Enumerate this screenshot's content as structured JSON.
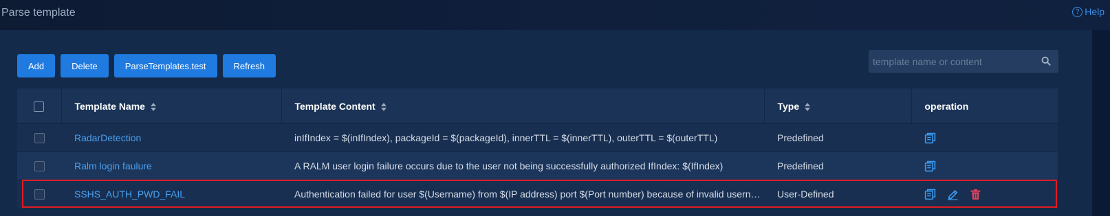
{
  "header": {
    "title": "Parse template",
    "help_label": "Help"
  },
  "toolbar": {
    "add_label": "Add",
    "delete_label": "Delete",
    "test_label": "ParseTemplates.test",
    "refresh_label": "Refresh"
  },
  "search": {
    "placeholder": "template name or content",
    "value": ""
  },
  "table": {
    "columns": [
      "Template Name",
      "Template Content",
      "Type",
      "operation"
    ],
    "rows": [
      {
        "name": "RadarDetection",
        "content": "inIfIndex = $(inIfIndex), packageId = $(packageId), innerTTL = $(innerTTL), outerTTL = $(outerTTL)",
        "type": "Predefined",
        "ops": [
          "copy-icon"
        ]
      },
      {
        "name": "Ralm login faulure",
        "content": "A RALM user login failure occurs due to the user not being successfully  authorized    IfIndex: $(IfIndex)",
        "type": "Predefined",
        "ops": [
          "copy-icon"
        ]
      },
      {
        "name": "SSHS_AUTH_PWD_FAIL",
        "content": "Authentication failed for user $(Username) from $(IP address) port $(Port number) because of invalid username or wrong password",
        "type": "User-Defined",
        "ops": [
          "copy-icon",
          "edit-icon",
          "delete-icon"
        ]
      }
    ]
  },
  "colors": {
    "accent": "#1f7be0",
    "link": "#4aa0f0",
    "danger": "#e0405a",
    "highlight": "#e21b22"
  }
}
